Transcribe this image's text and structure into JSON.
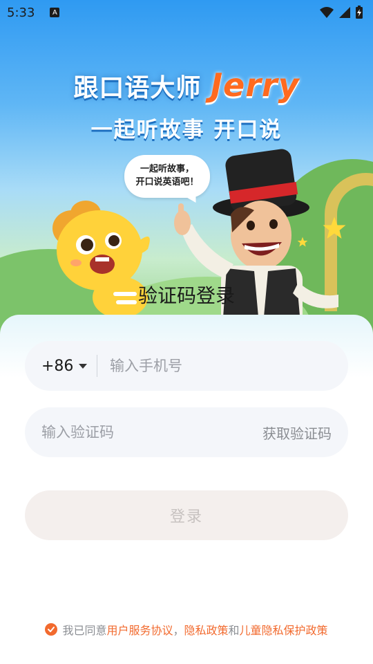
{
  "status_bar": {
    "time": "5:33",
    "notification_icon": "accessibility-a-icon",
    "icons": [
      "wifi-icon",
      "signal-icon",
      "battery-charging-icon"
    ]
  },
  "hero": {
    "title": "跟口语大师",
    "title_brand": "Jerry",
    "subtitle": "一起听故事 开口说",
    "bubble_line1": "一起听故事，",
    "bubble_line2": "开口说英语吧！"
  },
  "login": {
    "title": "验证码登录",
    "country_code": "+86",
    "phone_placeholder": "输入手机号",
    "code_placeholder": "输入验证码",
    "get_code_label": "获取验证码",
    "submit_label": "登录"
  },
  "agreement": {
    "prefix": "我已同意",
    "terms": "用户服务协议",
    "comma": "，",
    "privacy": "隐私政策",
    "and": "和",
    "child_privacy": "儿童隐私保护政策",
    "checked": true
  },
  "colors": {
    "accent": "#f26a2e",
    "sky": "#2f9af2",
    "field_bg": "#f4f6fa",
    "button_disabled_bg": "#f4efed"
  }
}
